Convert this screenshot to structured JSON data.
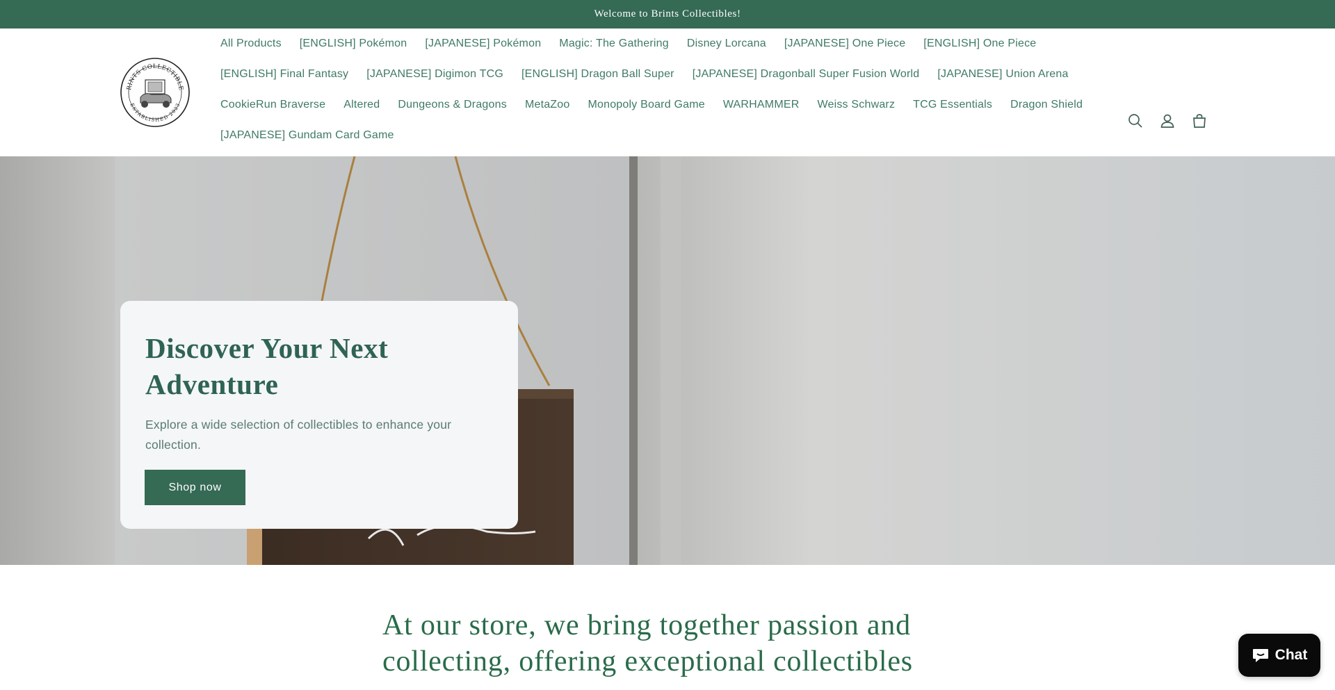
{
  "announcement": "Welcome to Brints Collectibles!",
  "logo": {
    "top_text": "BRINTS COLLECTIBLES",
    "bottom_text": "ESTABLISHED 2023"
  },
  "nav": {
    "rows": [
      [
        "All Products",
        "[ENGLISH] Pokémon",
        "[JAPANESE] Pokémon",
        "Magic: The Gathering",
        "Disney Lorcana",
        "[JAPANESE] One Piece",
        "[ENGLISH] One Piece"
      ],
      [
        "[ENGLISH] Final Fantasy",
        "[JAPANESE] Digimon TCG",
        "[ENGLISH] Dragon Ball Super",
        "[JAPANESE] Dragonball Super Fusion World",
        "[JAPANESE] Union Arena"
      ],
      [
        "CookieRun Braverse",
        "Altered",
        "Dungeons & Dragons",
        "MetaZoo",
        "Monopoly Board Game",
        "WARHAMMER",
        "Weiss Schwarz",
        "TCG Essentials",
        "Dragon Shield"
      ],
      [
        "[JAPANESE] Gundam Card Game"
      ]
    ]
  },
  "header_icons": [
    "search-icon",
    "account-icon",
    "cart-icon"
  ],
  "hero": {
    "title_line1": "Discover Your Next",
    "title_line2": "Adventure",
    "text": "Explore a wide selection of collectibles to enhance your collection.",
    "button": "Shop now"
  },
  "intro": {
    "line1": "At our store, we bring together passion and",
    "line2": "collecting, offering exceptional collectibles"
  },
  "chat": {
    "label": "Chat"
  },
  "colors": {
    "brand_green": "#356a55",
    "nav_text": "#3f7a66",
    "heading_green": "#2a6b4a",
    "chat_bg": "#0a0a0a"
  }
}
